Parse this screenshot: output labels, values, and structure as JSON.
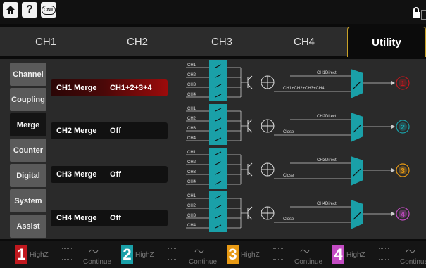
{
  "toolbar": {
    "home_icon": "home-icon",
    "help_label": "?",
    "cnt_label": "CNT"
  },
  "tabs": [
    {
      "label": "CH1"
    },
    {
      "label": "CH2"
    },
    {
      "label": "CH3"
    },
    {
      "label": "CH4"
    },
    {
      "label": "Utility"
    }
  ],
  "sidebar": {
    "items": [
      {
        "label": "Channel"
      },
      {
        "label": "Coupling"
      },
      {
        "label": "Merge",
        "active": true
      },
      {
        "label": "Counter"
      },
      {
        "label": "Digital"
      },
      {
        "label": "System"
      },
      {
        "label": "Assist"
      }
    ]
  },
  "merge_rows": [
    {
      "label": "CH1 Merge",
      "value": "CH1+2+3+4",
      "color": "#c0181e"
    },
    {
      "label": "CH2 Merge",
      "value": "Off",
      "color": "#1aa0a8"
    },
    {
      "label": "CH3 Merge",
      "value": "Off",
      "color": "#e89a14"
    },
    {
      "label": "CH4 Merge",
      "value": "Off",
      "color": "#c44cc4"
    }
  ],
  "diagram": {
    "inputs": [
      "CH1",
      "CH2",
      "CH3",
      "CH4"
    ],
    "blocks": [
      {
        "direct": "CH1Direct",
        "combined": "CH1+CH2+CH3+CH4",
        "out": "1"
      },
      {
        "direct": "CH2Direct",
        "combined": "Close",
        "out": "2"
      },
      {
        "direct": "CH3Direct",
        "combined": "Close",
        "out": "3"
      },
      {
        "direct": "CH4Direct",
        "combined": "Close",
        "out": "4"
      }
    ]
  },
  "bottom": [
    {
      "num": "1",
      "load": "HighZ",
      "mode": "Continue",
      "color": "#c0181e"
    },
    {
      "num": "2",
      "load": "HighZ",
      "mode": "Continue",
      "color": "#1aa0a8"
    },
    {
      "num": "3",
      "load": "HighZ",
      "mode": "Continue",
      "color": "#e89a14"
    },
    {
      "num": "4",
      "load": "HighZ",
      "mode": "Continue",
      "color": "#c44cc4"
    }
  ],
  "colors": {
    "accent": "#c9a227",
    "switch": "#1aa0a8"
  }
}
